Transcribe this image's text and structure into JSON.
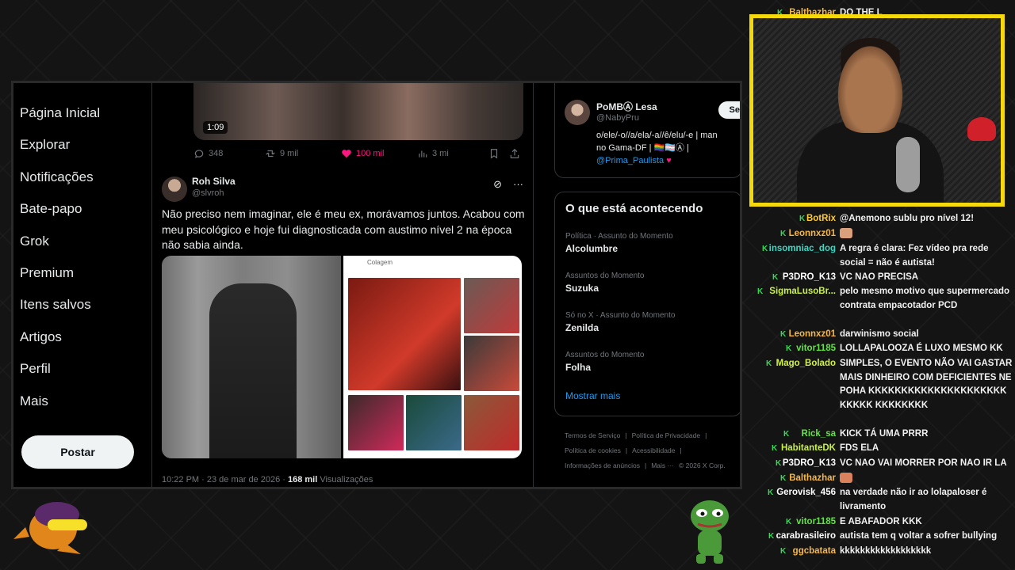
{
  "nav": {
    "items": [
      "Página Inicial",
      "Explorar",
      "Notificações",
      "Bate-papo",
      "Grok",
      "Premium",
      "Itens salvos",
      "Artigos",
      "Perfil",
      "Mais"
    ],
    "post_button": "Postar"
  },
  "video_post": {
    "duration": "1:09",
    "replies": "348",
    "retweets": "9 mil",
    "likes": "100 mil",
    "views": "3 mi"
  },
  "tweet": {
    "name": "Roh Silva",
    "handle": "@slvroh",
    "text": "Não preciso nem imaginar, ele é meu ex, morávamos juntos. Acabou com meu psicológico e hoje fui diagnosticada com austimo nível 2 na época não sabia ainda.",
    "collage_label": "Colagem",
    "timestamp_prefix": "10:22 PM · 23 de mar de 2026 · ",
    "views_count": "168 mil",
    "views_label": " Visualizações"
  },
  "who_to_follow": {
    "name": "PoMBⒶ Lesa",
    "handle": "@NabyPru",
    "follow_label": "Se",
    "bio_line1": "o/ele/-o//a/ela/-a//ê/elu/-e | man",
    "bio_line2": "no Gama-DF | 🏳️‍🌈🏳️‍⚧️Ⓐ |",
    "bio_link": "@Prima_Paulista",
    "bio_heart": " ♥"
  },
  "trends": {
    "title": "O que está acontecendo",
    "items": [
      {
        "meta": "Política · Assunto do Momento",
        "name": "Alcolumbre"
      },
      {
        "meta": "Assuntos do Momento",
        "name": "Suzuka"
      },
      {
        "meta": "Só no X · Assunto do Momento",
        "name": "Zenilda"
      },
      {
        "meta": "Assuntos do Momento",
        "name": "Folha"
      }
    ],
    "show_more": "Mostrar mais"
  },
  "footer": {
    "links": [
      "Termos de Serviço",
      "|",
      "Política de Privacidade",
      "|",
      "Política de cookies",
      "|",
      "Acessibilidade",
      "|",
      "Informações de anúncios",
      "|",
      "Mais ···",
      "© 2026 X Corp."
    ]
  },
  "chat": {
    "messages": [
      {
        "user": "Balthazhar",
        "text": "DO THE L",
        "color": "#f5b84a"
      },
      {
        "user": "BotRix",
        "text": "@Anemono sublu pro nível 12!",
        "color": "#ffcc33"
      },
      {
        "user": "Leonnxz01",
        "text": "",
        "color": "#f5b84a",
        "emote": true
      },
      {
        "user": "insomniac_dog",
        "text": "A regra é clara: Fez vídeo pra rede social = não é autista!",
        "color": "#3cd6c2"
      },
      {
        "user": "P3DRO_K13",
        "text": "VC NAO PRECISA",
        "color": "#ffffff"
      },
      {
        "user": "SigmaLusoBr...",
        "text": "pelo mesmo motivo que supermercado contrata empacotador PCD",
        "color": "#c9f04a"
      },
      {
        "user": "Leonnxz01",
        "text": "darwinismo social",
        "color": "#f5b84a"
      },
      {
        "user": "vitor1185",
        "text": "LOLLAPALOOZA É LUXO MESMO KK",
        "color": "#66e04a"
      },
      {
        "user": "Mago_Bolado",
        "text": "SIMPLES, O EVENTO NÃO VAI GASTAR MAIS DINHEIRO COM DEFICIENTES NE POHA KKKKKKKKKKKKKKKKKKKKKKKKKK KKKKKKKK",
        "color": "#d2f04a"
      },
      {
        "user": "Rick_sa",
        "text": "KICK TÁ UMA PRRR",
        "color": "#66e04a"
      },
      {
        "user": "HabitanteDK",
        "text": "FDS ELA",
        "color": "#c9f04a"
      },
      {
        "user": "P3DRO_K13",
        "text": "VC NAO VAI MORRER POR NAO IR LA",
        "color": "#ffffff"
      },
      {
        "user": "Balthazhar",
        "text": "",
        "color": "#f5b84a",
        "emote": true
      },
      {
        "user": "Gerovisk_456",
        "text": "na verdade não ir ao lolapaloser é livramento",
        "color": "#ffffff"
      },
      {
        "user": "vitor1185",
        "text": "E ABAFADOR KKK",
        "color": "#66e04a"
      },
      {
        "user": "carabrasileiro",
        "text": "autista tem q voltar a sofrer bullying",
        "color": "#ffffff"
      },
      {
        "user": "ggcbatata",
        "text": "kkkkkkkkkkkkkkkkkk",
        "color": "#f5b84a"
      }
    ]
  },
  "colors": {
    "accent_blue": "#1d9bf0",
    "like_pink": "#f91880",
    "webcam_border": "#f5d90a",
    "kick_green": "#3cd65b"
  }
}
